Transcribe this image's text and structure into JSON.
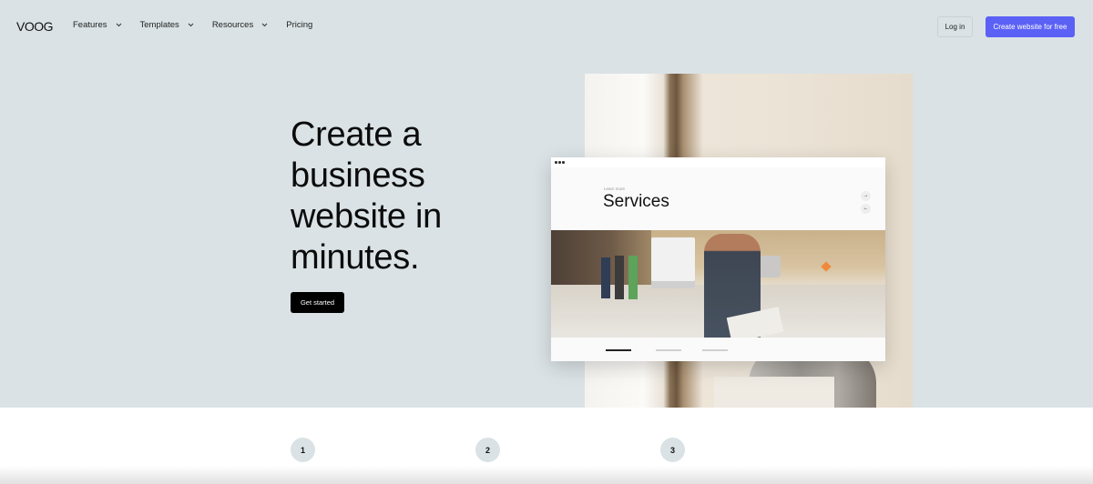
{
  "header": {
    "logo_text": "VOOG",
    "nav": [
      {
        "label": "Features",
        "has_dropdown": true
      },
      {
        "label": "Templates",
        "has_dropdown": true
      },
      {
        "label": "Resources",
        "has_dropdown": true
      },
      {
        "label": "Pricing",
        "has_dropdown": false
      }
    ],
    "login_label": "Log in",
    "cta_label": "Create website for free"
  },
  "hero": {
    "headline_lines": [
      "Create a",
      "business",
      "website in",
      "minutes."
    ],
    "get_started_label": "Get started"
  },
  "mockup": {
    "kicker": "Learn more",
    "title": "Services",
    "arrow_next": "→",
    "arrow_prev": "←",
    "slide_count": 3,
    "active_slide": 1
  },
  "steps": [
    "1",
    "2",
    "3"
  ],
  "colors": {
    "hero_bg": "#dae2e5",
    "accent": "#5b61f5",
    "primary_button": "#000000"
  }
}
